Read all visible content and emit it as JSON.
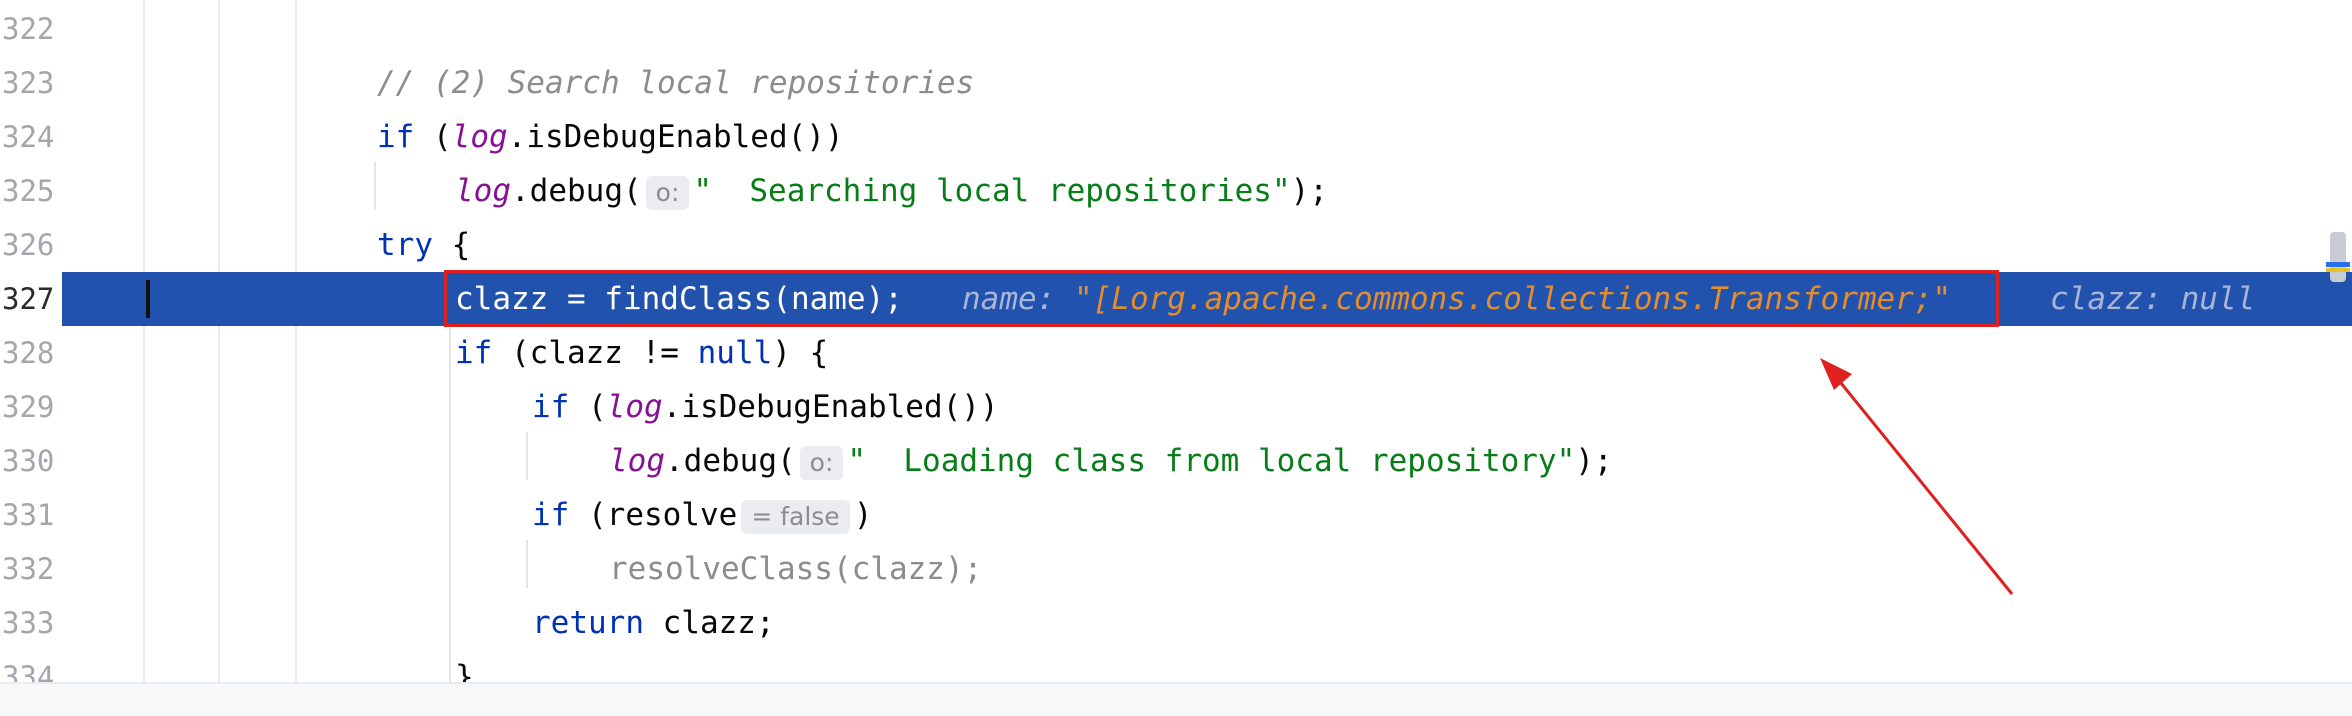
{
  "lines": [
    {
      "num": "322"
    },
    {
      "num": "323",
      "comment": "// (2) Search local repositories"
    },
    {
      "num": "324",
      "kw": "if",
      "open": " (",
      "field": "log",
      "rest": ".isDebugEnabled())"
    },
    {
      "num": "325",
      "field": "log",
      "call": ".debug(",
      "hint": "o:",
      "str": "\"  Searching local repositories\"",
      "end": ");"
    },
    {
      "num": "326",
      "kw": "try",
      "rest": " {"
    },
    {
      "num": "327",
      "code": "clazz = findClass(name);",
      "dbg1_name": "name: ",
      "dbg1_val": "\"[Lorg.apache.commons.collections.Transformer;\"",
      "dbg2": "clazz: null"
    },
    {
      "num": "328",
      "kw": "if",
      "mid": " (clazz != ",
      "kw2": "null",
      "rest": ") {"
    },
    {
      "num": "329",
      "kw": "if",
      "open": " (",
      "field": "log",
      "rest": ".isDebugEnabled())"
    },
    {
      "num": "330",
      "field": "log",
      "call": ".debug(",
      "hint": "o:",
      "str": "\"  Loading class from local repository\"",
      "end": ");"
    },
    {
      "num": "331",
      "kw": "if",
      "mid": " (resolve",
      "hint": "= false",
      "rest": ")"
    },
    {
      "num": "332",
      "dim": "resolveClass(clazz);"
    },
    {
      "num": "333",
      "kw": "return",
      "rest": " clazz;"
    },
    {
      "num": "334",
      "rest": "}"
    }
  ],
  "colors": {
    "current_line": "#2152ad",
    "keyword": "#0033b3",
    "field": "#871094",
    "string": "#067d17",
    "comment": "#8c8c8c",
    "debug_value": "#e58d2c",
    "annotation_red": "#e0201f"
  }
}
